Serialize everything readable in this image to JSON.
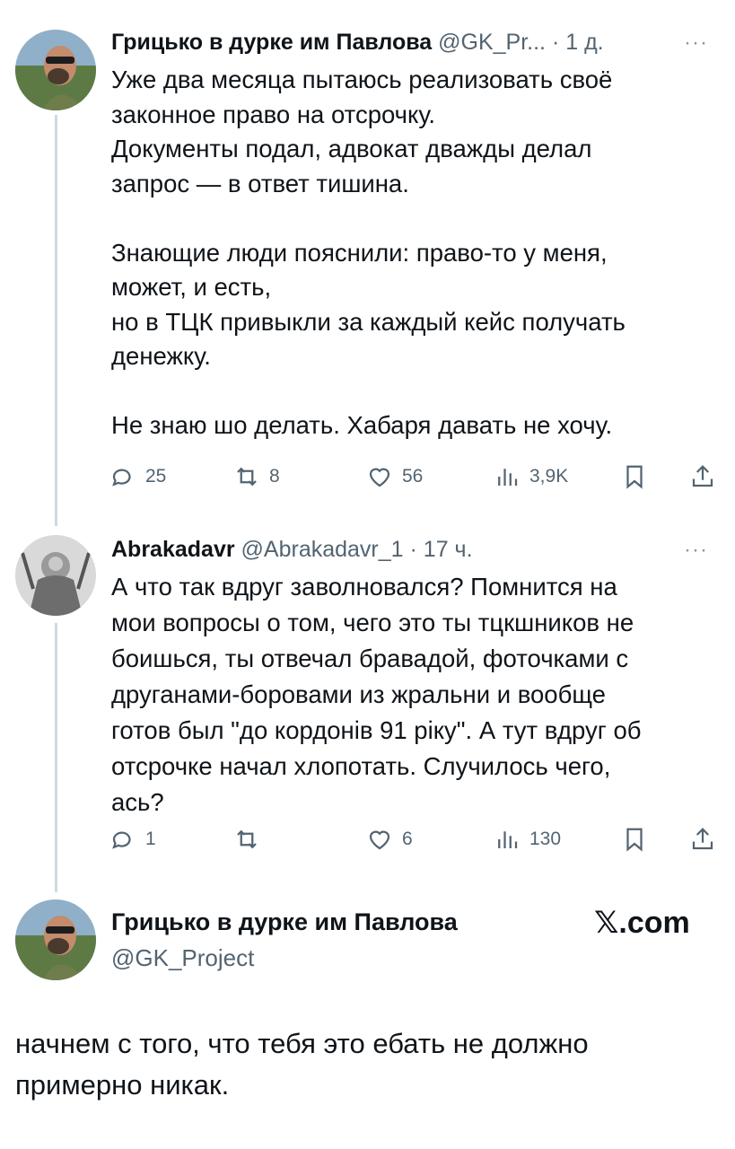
{
  "tweet1": {
    "name": "Грицько в дурке им Павлова",
    "handle": "@GK_Pr...",
    "time": "· 1 д.",
    "more": "···",
    "text": "Уже два месяца пытаюсь реализовать своё\nзаконное право на отсрочку.\nДокументы подал, адвокат дважды делал\nзапрос — в ответ тишина.\n\nЗнающие люди пояснили: право-то у меня,\nможет, и есть,\nно в ТЦК привыкли за каждый кейс получать\nденежку.\n\nНе знаю шо делать. Хабаря давать не хочу.",
    "replies": "25",
    "reposts": "8",
    "likes": "56",
    "views": "3,9K",
    "icons": [
      "reply-icon",
      "repost-icon",
      "like-icon",
      "views-icon",
      "bookmark-icon",
      "share-icon"
    ]
  },
  "tweet2": {
    "name": "Abrakadavr",
    "handle": "@Abrakadavr_1",
    "time": "· 17 ч.",
    "more": "···",
    "text": "А что так вдруг заволновался? Помнится на\nмои вопросы о том, чего это ты тцкшников не\nбоишься, ты отвечал бравадой, фоточками с\nдруганами-боровами из жральни и вообще\nготов был \"до кордонів 91 ріку\". А тут вдруг об\nотсрочке начал хлопотать. Случилось чего,\nась?",
    "replies": "1",
    "reposts": "",
    "likes": "6",
    "views": "130"
  },
  "reply": {
    "name": "Грицько в дурке им Павлова",
    "handle": "@GK_Project",
    "logo": "𝕏.com",
    "text": "начнем с того, что тебя это ебать не должно\nпримерно никак."
  },
  "colors": {
    "text": "#0f1419",
    "secondary": "#536471",
    "thread_line": "#cfd9de"
  }
}
